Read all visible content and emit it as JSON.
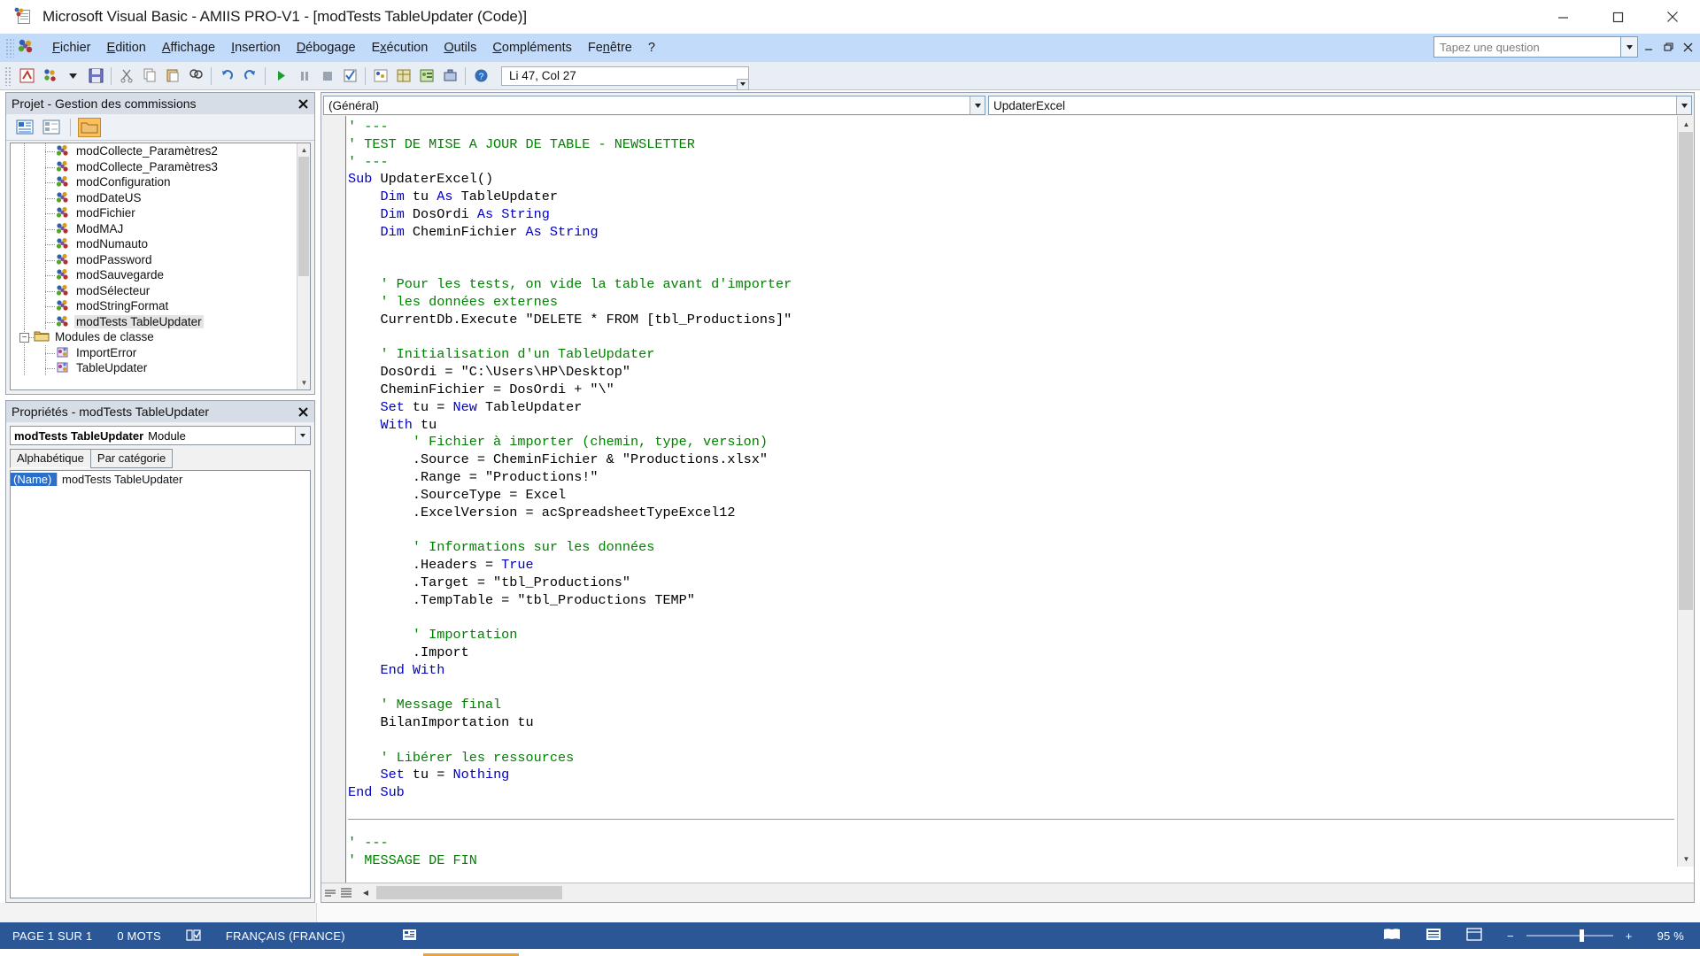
{
  "window": {
    "title": "Microsoft Visual Basic - AMIIS PRO-V1 - [modTests TableUpdater (Code)]",
    "minimize": "—",
    "maximize": "☐",
    "close": "✕"
  },
  "menu": {
    "items": [
      {
        "label": "Fichier",
        "accel": "F"
      },
      {
        "label": "Edition",
        "accel": "E"
      },
      {
        "label": "Affichage",
        "accel": "A"
      },
      {
        "label": "Insertion",
        "accel": "I"
      },
      {
        "label": "Débogage",
        "accel": "D"
      },
      {
        "label": "Exécution",
        "accel": "x"
      },
      {
        "label": "Outils",
        "accel": "O"
      },
      {
        "label": "Compléments",
        "accel": "C"
      },
      {
        "label": "Fenêtre",
        "accel": "n"
      },
      {
        "label": "?",
        "accel": ""
      }
    ],
    "ask_placeholder": "Tapez une question",
    "minimize_doc": "–",
    "restore_doc": "❐",
    "close_doc": "✕"
  },
  "toolbar": {
    "position_value": "Li 47, Col 27",
    "buttons": [
      "view-access-icon",
      "insert-module-icon",
      "insert-dropdown-icon",
      "save-icon",
      "cut-icon",
      "copy-icon",
      "paste-icon",
      "find-icon",
      "undo-icon",
      "redo-icon",
      "run-icon",
      "break-icon",
      "reset-icon",
      "design-mode-icon",
      "project-explorer-icon",
      "properties-window-icon",
      "object-browser-icon",
      "toolbox-icon",
      "help-icon"
    ]
  },
  "project_panel": {
    "title": "Projet - Gestion des commissions",
    "close_label": "✕",
    "toolbar_buttons": [
      "view-code-icon",
      "view-object-icon",
      "toggle-folders-icon"
    ],
    "tree": [
      {
        "label": "modCollecte_Paramètres2",
        "level": 2,
        "icon": "module-icon",
        "selected": false
      },
      {
        "label": "modCollecte_Paramètres3",
        "level": 2,
        "icon": "module-icon",
        "selected": false
      },
      {
        "label": "modConfiguration",
        "level": 2,
        "icon": "module-icon",
        "selected": false
      },
      {
        "label": "modDateUS",
        "level": 2,
        "icon": "module-icon",
        "selected": false
      },
      {
        "label": "modFichier",
        "level": 2,
        "icon": "module-icon",
        "selected": false
      },
      {
        "label": "ModMAJ",
        "level": 2,
        "icon": "module-icon",
        "selected": false
      },
      {
        "label": "modNumauto",
        "level": 2,
        "icon": "module-icon",
        "selected": false
      },
      {
        "label": "modPassword",
        "level": 2,
        "icon": "module-icon",
        "selected": false
      },
      {
        "label": "modSauvegarde",
        "level": 2,
        "icon": "module-icon",
        "selected": false
      },
      {
        "label": "modSélecteur",
        "level": 2,
        "icon": "module-icon",
        "selected": false
      },
      {
        "label": "modStringFormat",
        "level": 2,
        "icon": "module-icon",
        "selected": false
      },
      {
        "label": "modTests TableUpdater",
        "level": 2,
        "icon": "module-icon",
        "selected": true
      },
      {
        "label": "Modules de classe",
        "level": 1,
        "icon": "folder-icon",
        "selected": false,
        "expander": "−"
      },
      {
        "label": "ImportError",
        "level": 2,
        "icon": "class-module-icon",
        "selected": false
      },
      {
        "label": "TableUpdater",
        "level": 2,
        "icon": "class-module-icon",
        "selected": false
      }
    ]
  },
  "properties_panel": {
    "title": "Propriétés - modTests TableUpdater",
    "close_label": "✕",
    "object_name": "modTests TableUpdater",
    "object_type": "Module",
    "tabs": [
      {
        "label": "Alphabétique",
        "active": true
      },
      {
        "label": "Par catégorie",
        "active": false
      }
    ],
    "rows": [
      {
        "key": "(Name)",
        "value": "modTests TableUpdater"
      }
    ]
  },
  "code_window": {
    "object_dropdown": "(Général)",
    "procedure_dropdown": "UpdaterExcel",
    "dropdown_arrow": "▾",
    "footer_buttons": [
      "procedure-view-icon",
      "full-module-view-icon"
    ],
    "code_top": "' ---\n' TEST DE MISE A JOUR DE TABLE - NEWSLETTER\n' ---\nSub UpdaterExcel()\n    Dim tu As TableUpdater\n    Dim DosOrdi As String\n    Dim CheminFichier As String\n\n\n    ' Pour les tests, on vide la table avant d'importer\n    ' les données externes\n    CurrentDb.Execute \"DELETE * FROM [tbl_Productions]\"\n\n    ' Initialisation d'un TableUpdater\n    DosOrdi = \"C:\\Users\\HP\\Desktop\"\n    CheminFichier = DosOrdi + \"\\\"\n    Set tu = New TableUpdater\n    With tu\n        ' Fichier à importer (chemin, type, version)\n        .Source = CheminFichier & \"Productions.xlsx\"\n        .Range = \"Productions!\"\n        .SourceType = Excel\n        .ExcelVersion = acSpreadsheetTypeExcel12\n\n        ' Informations sur les données\n        .Headers = True\n        .Target = \"tbl_Productions\"\n        .TempTable = \"tbl_Productions TEMP\"\n\n        ' Importation\n        .Import\n    End With\n\n    ' Message final\n    BilanImportation tu\n\n    ' Libérer les ressources\n    Set tu = Nothing\nEnd Sub",
    "code_bottom": "' ---\n' MESSAGE DE FIN"
  },
  "status_bar": {
    "page": "PAGE 1 SUR 1",
    "words": "0 MOTS",
    "proofing_icon": "proofing-icon",
    "language": "FRANÇAIS (FRANCE)",
    "macro_icon": "macro-record-icon",
    "read_mode_icon": "read-mode-icon",
    "print_layout_icon": "print-layout-icon",
    "web_layout_icon": "web-layout-icon",
    "zoom_out": "−",
    "zoom_in": "+",
    "zoom_level": "95 %"
  },
  "colors": {
    "menu_blue": "#c3dbfa",
    "status_blue": "#2b5797",
    "comment_green": "#008000",
    "keyword_blue": "#0000c0",
    "selected_gray": "#e4e4e4"
  }
}
